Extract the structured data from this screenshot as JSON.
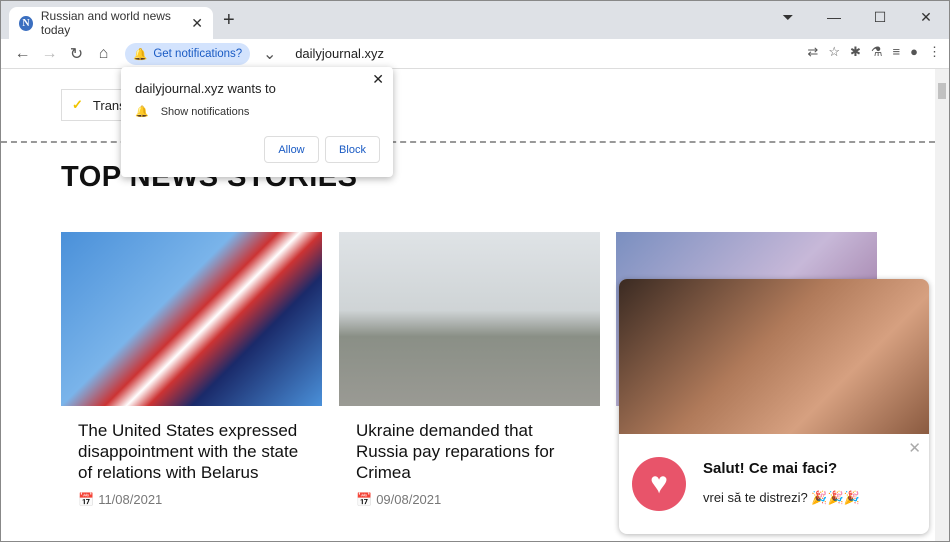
{
  "tab": {
    "title": "Russian and world news today",
    "favicon": "N"
  },
  "toolbar": {
    "chip": "Get notifications?",
    "url": "dailyjournal.xyz"
  },
  "popup": {
    "title": "dailyjournal.xyz wants to",
    "permission": "Show notifications",
    "allow": "Allow",
    "block": "Block"
  },
  "page": {
    "translate": "Trans",
    "heading": "TOP NEWS STORIES",
    "articles": [
      {
        "title": "The United States expressed disappointment with the state of relations with Belarus",
        "date": "11/08/2021"
      },
      {
        "title": "Ukraine demanded that Russia pay reparations for Crimea",
        "date": "09/08/2021"
      }
    ]
  },
  "ad": {
    "title": "Salut! Ce mai faci?",
    "text": "vrei să te distrezi? 🎉🎉🎉"
  }
}
